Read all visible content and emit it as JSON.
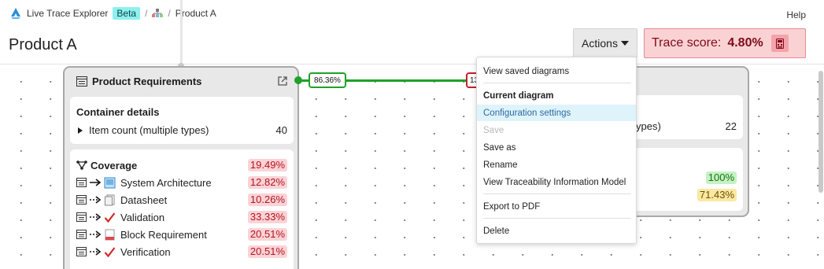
{
  "app": {
    "name": "Live Trace Explorer",
    "badge": "Beta",
    "breadcrumb_sep": "/",
    "breadcrumb_current": "Product A",
    "help_label": "Help"
  },
  "page": {
    "title": "Product A"
  },
  "toolbar": {
    "actions_label": "Actions",
    "trace_score_label": "Trace score:",
    "trace_score_value": "4.80%"
  },
  "left_card": {
    "title": "Product Requirements",
    "details_title": "Container details",
    "item_count_label": "Item count (multiple types)",
    "item_count": "40",
    "coverage_label": "Coverage",
    "coverage_value": "19.49%",
    "rows": [
      {
        "label": "System Architecture",
        "value": "12.82%",
        "icon": "architecture-icon"
      },
      {
        "label": "Datasheet",
        "value": "10.26%",
        "icon": "datasheet-icon"
      },
      {
        "label": "Validation",
        "value": "33.33%",
        "icon": "check-icon"
      },
      {
        "label": "Block Requirement",
        "value": "20.51%",
        "icon": "block-requirement-icon"
      },
      {
        "label": "Verification",
        "value": "20.51%",
        "icon": "check-icon"
      }
    ]
  },
  "link": {
    "left_label": "86.36%",
    "right_label": "13"
  },
  "right_card": {
    "item_count_label_partial": "ypes)",
    "item_count": "22",
    "value_1": "100%",
    "value_2": "71.43%"
  },
  "menu": {
    "items": [
      {
        "label": "View saved diagrams",
        "state": "normal"
      },
      {
        "label": "Current diagram",
        "state": "header"
      },
      {
        "label": "Configuration settings",
        "state": "active"
      },
      {
        "label": "Save",
        "state": "disabled"
      },
      {
        "label": "Save as",
        "state": "normal"
      },
      {
        "label": "Rename",
        "state": "normal"
      },
      {
        "label": "View Traceability Information Model",
        "state": "normal"
      },
      {
        "label": "Export to PDF",
        "state": "normal"
      },
      {
        "label": "Delete",
        "state": "normal"
      }
    ]
  },
  "colors": {
    "accent_green": "#1fa12a",
    "score_bg": "#fbd2d4",
    "score_text": "#7e0a18",
    "beta_bg": "#8ef0ef"
  }
}
